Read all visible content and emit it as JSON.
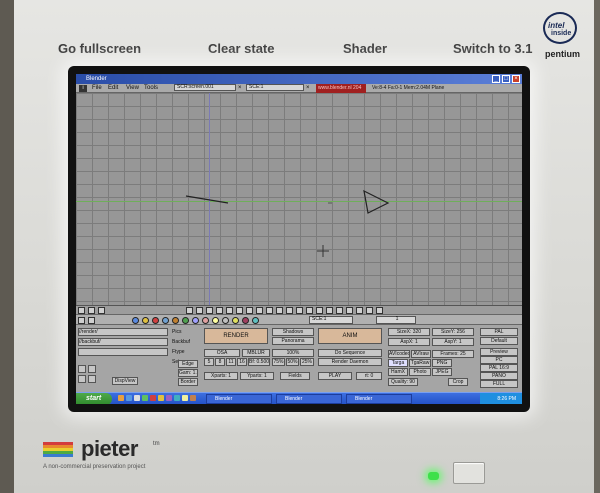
{
  "top_buttons": [
    "Go fullscreen",
    "Clear state",
    "Shader",
    "Switch to 3.1"
  ],
  "badge": {
    "line1": "intel",
    "line2": "inside",
    "line3": "pentium"
  },
  "window": {
    "title": "Blender",
    "controls": [
      "_",
      "□",
      "×"
    ]
  },
  "menubar": {
    "items": [
      "File",
      "Edit",
      "View",
      "Tools"
    ],
    "screen_field": "SCR:screen.001",
    "scene_field": "SCE:1",
    "website": "www.blender.nl 204",
    "stats": "Ve:8-4 Fa:0-1 Mem:2.04M Plane"
  },
  "panels": {
    "render_button": "RENDER",
    "anim_button": "ANIM",
    "play_button": "PLAY",
    "shadows": "Shadows",
    "panorama": "Panorama",
    "osa": "OSA",
    "mblur": "MBLUR",
    "pct": "100%",
    "xparts": "Xparts: 1",
    "yparts": "Yparts: 1",
    "fields": "Fields",
    "bf": "Bf: 0.500",
    "rt": "rt: 0",
    "osa_values": [
      "5",
      "8",
      "11",
      "16"
    ],
    "pct_values": [
      "75%",
      "50%",
      "25%"
    ],
    "do_sequence": "Do Sequence",
    "render_daemon": "Render Daemon",
    "sizex": "SizeX: 320",
    "sizey": "SizeY: 256",
    "aspx": "AspX: 1",
    "aspy": "AspY: 1",
    "avicodec": "AVIcodec",
    "avi_raw": "AVIraw",
    "frames": "Frames: 25",
    "targa": "Targa",
    "tga_raw": "TgaRaw",
    "png": "PNG",
    "hamx": "HamX",
    "photo": "Photo",
    "jpeg": "JPEG",
    "quality": "Quality: 90",
    "crop": "Crop",
    "presets": [
      "PAL",
      "Default",
      "Preview",
      "PC",
      "PAL 16:9",
      "PANO",
      "FULL"
    ],
    "sidebar_labels": [
      "Pics",
      "Backbuf",
      "Ftype"
    ],
    "dispview": "DispView",
    "edge": "Edge",
    "gamma": "Gam: 1.0",
    "border": "Border",
    "scene_label": "SCE:1",
    "frame_label": "1",
    "left_fields": [
      "//render/",
      "//backbuf/"
    ],
    "set": "Set"
  },
  "taskbar": {
    "start": "start",
    "buttons": [
      "Blender",
      "Blender",
      "Blender"
    ],
    "time": "8:26 PM"
  },
  "logo": {
    "name": "pieter",
    "tm": "tm",
    "subtitle": "A non-commercial preservation project"
  },
  "colors": {
    "led": "#3ee04a",
    "title_blue": "#2a4da8",
    "taskbar_blue": "#2452c8",
    "start_green": "#3f9a3b",
    "render_button": "#d8b89a"
  }
}
